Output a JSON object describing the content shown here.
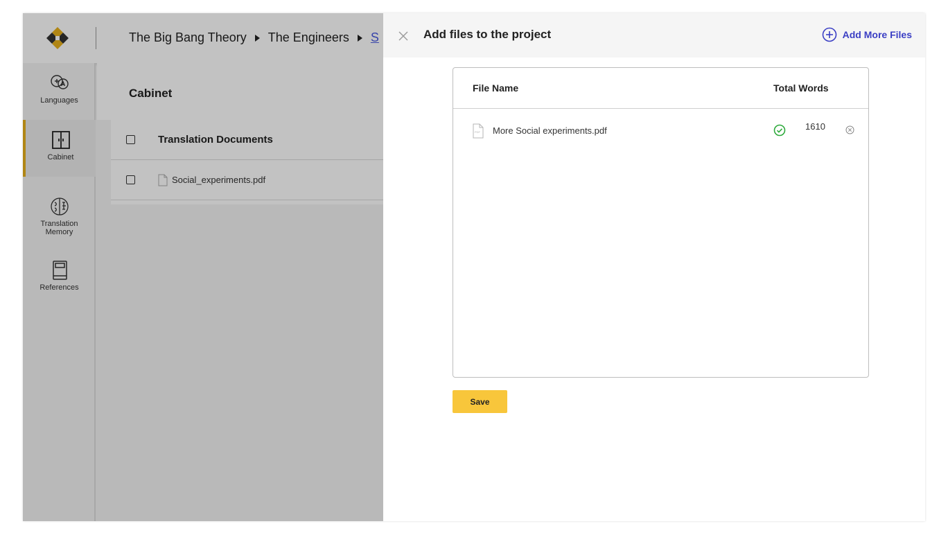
{
  "colors": {
    "accent_gold": "#e8b11c",
    "link_blue": "#3b3fc4",
    "success_green": "#2eaa3c",
    "save_yellow": "#f8c63b"
  },
  "breadcrumb": {
    "items": [
      "The Big Bang Theory",
      "The Engineers",
      "S"
    ]
  },
  "sidebar": {
    "items": [
      {
        "label": "Languages",
        "icon": "languages-icon"
      },
      {
        "label": "Cabinet",
        "icon": "cabinet-icon"
      },
      {
        "label_line1": "Translation",
        "label_line2": "Memory",
        "icon": "brain-icon"
      },
      {
        "label": "References",
        "icon": "book-icon"
      }
    ]
  },
  "cabinet": {
    "title": "Cabinet",
    "header": "Translation Documents",
    "files": [
      "Social_experiments.pdf"
    ]
  },
  "drawer": {
    "title": "Add files to the project",
    "add_more_label": "Add More Files",
    "columns": {
      "file_name": "File Name",
      "total_words": "Total Words"
    },
    "files": [
      {
        "name": "More Social experiments.pdf",
        "words": "1610",
        "status": "check-icon"
      }
    ],
    "save_label": "Save"
  }
}
